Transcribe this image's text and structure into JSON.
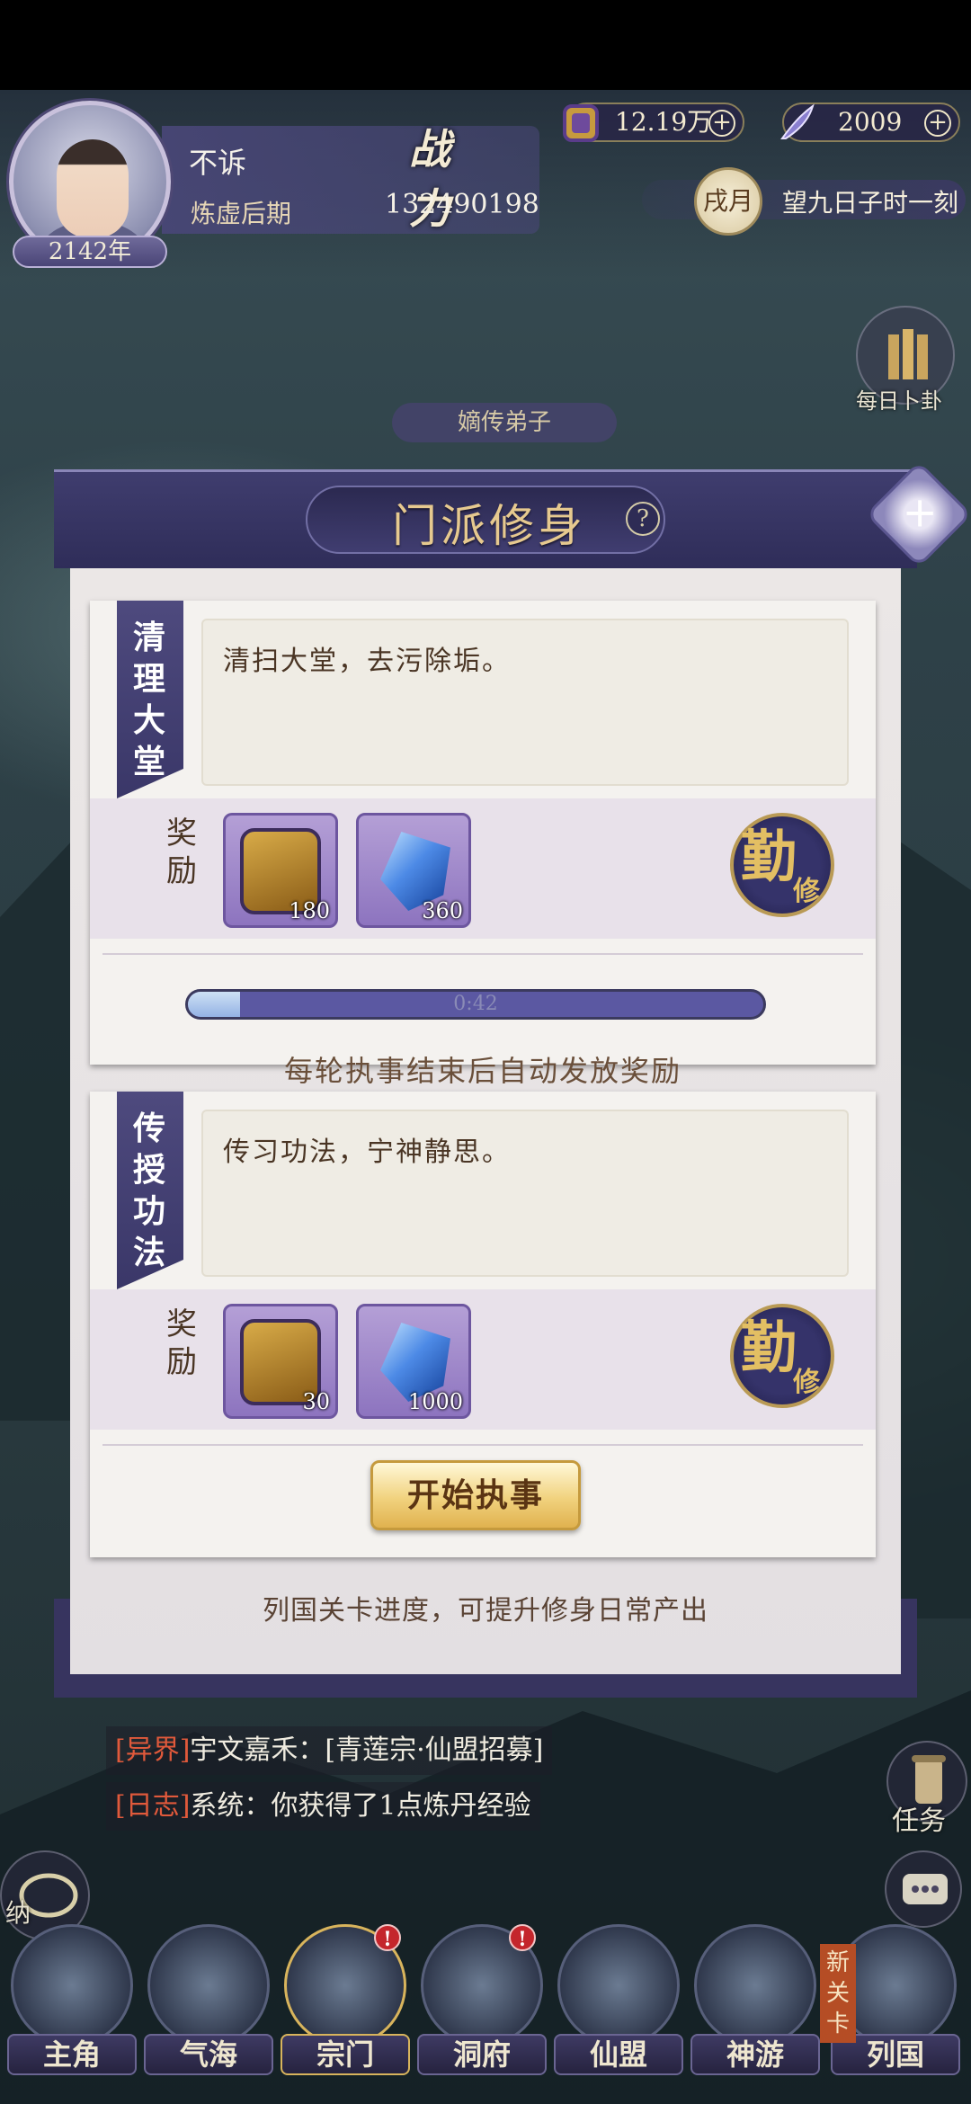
{
  "player": {
    "name": "不诉",
    "realm": "炼虚后期",
    "age": "2142年",
    "power_label": "战力",
    "power": "132490198"
  },
  "currencies": [
    {
      "icon": "token-icon",
      "value": "12.19万"
    },
    {
      "icon": "feather-icon",
      "value": "2009"
    }
  ],
  "time": {
    "month": "戌月",
    "text": "望九日子时一刻"
  },
  "side_buttons": {
    "daily_divination": "每日卜卦",
    "tasks": "任务",
    "storage": "纳"
  },
  "behind_tag": "嫡传弟子",
  "dialog": {
    "title": "门派修身",
    "help": "?",
    "tasks": [
      {
        "name_lines": [
          "清",
          "理",
          "大",
          "堂"
        ],
        "description": "清扫大堂，去污除垢。",
        "reward_label_lines": [
          "奖",
          "励"
        ],
        "rewards": [
          {
            "type": "token",
            "count": "180"
          },
          {
            "type": "crystal",
            "count": "360"
          }
        ],
        "badge_big": "勤",
        "badge_small": "修",
        "progress_time": "0:42",
        "progress_fraction": 0.09,
        "note": "每轮执事结束后自动发放奖励"
      },
      {
        "name_lines": [
          "传",
          "授",
          "功",
          "法"
        ],
        "description": "传习功法，宁神静思。",
        "reward_label_lines": [
          "奖",
          "励"
        ],
        "rewards": [
          {
            "type": "token",
            "count": "30"
          },
          {
            "type": "crystal",
            "count": "1000"
          }
        ],
        "badge_big": "勤",
        "badge_small": "修"
      }
    ],
    "start_button": "开始执事",
    "footer": "列国关卡进度，可提升修身日常产出"
  },
  "chat": [
    {
      "tag": "[异界]",
      "speaker": "宇文嘉禾：",
      "message": "[青莲宗·仙盟招募]"
    },
    {
      "tag": "[日志]",
      "speaker": "系统：",
      "message": "你获得了1点炼丹经验"
    }
  ],
  "nav": [
    {
      "label": "主角",
      "badge": ""
    },
    {
      "label": "气海",
      "badge": ""
    },
    {
      "label": "宗门",
      "badge": "!"
    },
    {
      "label": "洞府",
      "badge": "!"
    },
    {
      "label": "仙盟",
      "badge": ""
    },
    {
      "label": "神游",
      "badge": ""
    },
    {
      "label": "列国",
      "badge": ""
    }
  ],
  "new_stage_lines": [
    "新",
    "关",
    "卡"
  ],
  "colors": {
    "panel_purple": "#3f3d6e",
    "gold_text": "#e6c98f",
    "alert_red": "#c4262c"
  }
}
